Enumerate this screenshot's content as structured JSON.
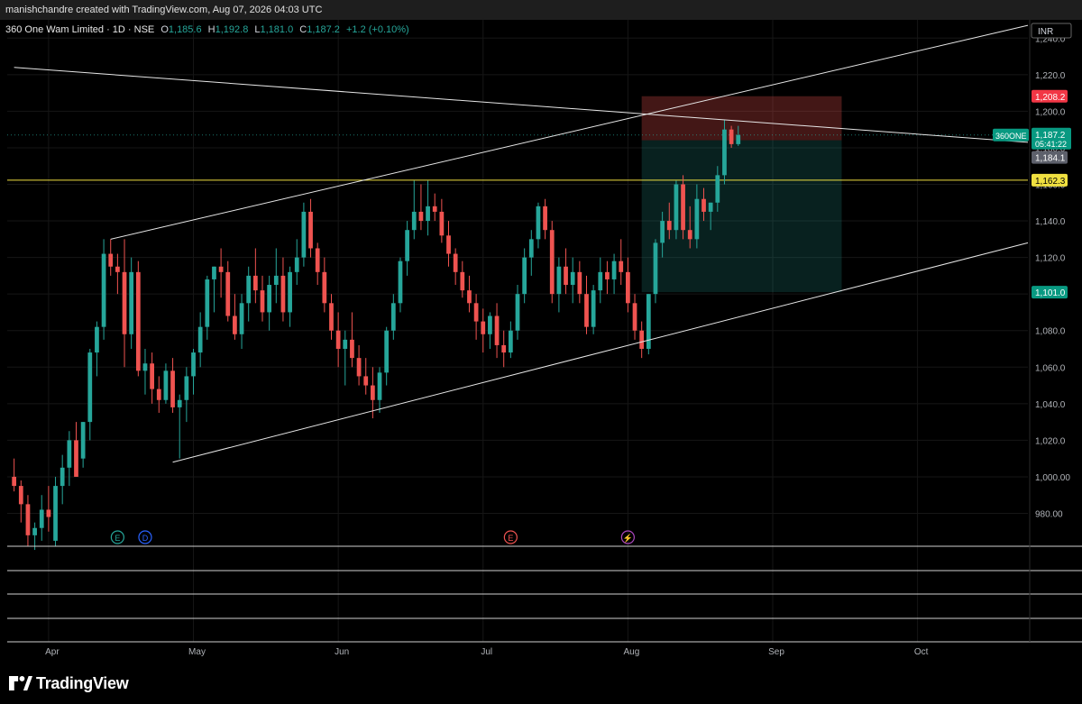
{
  "header": {
    "created_by": "manishchandre created with TradingView.com, Aug 07, 2026 04:03 UTC"
  },
  "legend": {
    "title": "360 One Wam Limited · 1D · NSE",
    "open_label": "O",
    "open": "1,185.6",
    "high_label": "H",
    "high": "1,192.8",
    "low_label": "L",
    "low": "1,181.0",
    "close_label": "C",
    "close": "1,187.2",
    "change": "+1.2 (+0.10%)"
  },
  "currency": "INR",
  "price_tags": {
    "stop": "1,208.2",
    "symbol": "360ONE",
    "last": "1,187.2",
    "countdown": "05:41:22",
    "prev": "1,184.1",
    "hline": "1,162.3",
    "target": "1,101.0"
  },
  "colors": {
    "up": "#26a69a",
    "down": "#ef5350",
    "hline": "#f0e040",
    "background": "#000000"
  },
  "events": [
    {
      "label": "E",
      "kind": "earnings"
    },
    {
      "label": "D",
      "kind": "dividend"
    },
    {
      "label": "E",
      "kind": "earnings"
    },
    {
      "label": "⚡",
      "kind": "split"
    }
  ],
  "brand": "TradingView",
  "chart_data": {
    "type": "candlestick",
    "symbol": "360ONE",
    "ylim": [
      962,
      1250
    ],
    "y_ticks": [
      "980.00",
      "1,000.00",
      "1,020.0",
      "1,040.0",
      "1,060.0",
      "1,080.0",
      "1,100.0",
      "1,120.0",
      "1,140.0",
      "1,160.0",
      "1,180.0",
      "1,200.0",
      "1,220.0",
      "1,240.0"
    ],
    "y_tick_values": [
      980,
      1000,
      1020,
      1040,
      1060,
      1080,
      1100,
      1120,
      1140,
      1160,
      1180,
      1200,
      1220,
      1240
    ],
    "x_ticks": [
      {
        "label": "Apr",
        "index": 5
      },
      {
        "label": "May",
        "index": 26
      },
      {
        "label": "Jun",
        "index": 47
      },
      {
        "label": "Jul",
        "index": 68
      },
      {
        "label": "Aug",
        "index": 89
      },
      {
        "label": "Sep",
        "index": 110
      },
      {
        "label": "Oct",
        "index": 131
      }
    ],
    "x_range": [
      -1,
      147
    ],
    "horizontal_line": 1162.3,
    "position": {
      "type": "short",
      "entry": 1184.1,
      "stop": 1208.2,
      "target": 1101.0,
      "start_index": 91,
      "end_index": 120
    },
    "trendlines": [
      {
        "name": "upper channel",
        "from": [
          14,
          1130
        ],
        "to": [
          147,
          1247
        ]
      },
      {
        "name": "lower channel",
        "from": [
          23,
          1008
        ],
        "to": [
          147,
          1128
        ]
      },
      {
        "name": "descending",
        "from": [
          0,
          1224
        ],
        "to": [
          147,
          1183
        ]
      }
    ],
    "candles": [
      [
        1000,
        1010,
        992,
        995
      ],
      [
        995,
        998,
        975,
        985
      ],
      [
        985,
        990,
        962,
        968
      ],
      [
        968,
        975,
        960,
        972
      ],
      [
        972,
        990,
        965,
        982
      ],
      [
        982,
        995,
        970,
        978
      ],
      [
        965,
        1000,
        962,
        995
      ],
      [
        995,
        1012,
        985,
        1005
      ],
      [
        1005,
        1025,
        995,
        1020
      ],
      [
        1020,
        1030,
        1000,
        1000
      ],
      [
        1010,
        1030,
        1005,
        1030
      ],
      [
        1030,
        1070,
        1020,
        1068
      ],
      [
        1068,
        1085,
        1055,
        1082
      ],
      [
        1082,
        1130,
        1075,
        1122
      ],
      [
        1122,
        1130,
        1110,
        1115
      ],
      [
        1115,
        1122,
        1100,
        1112
      ],
      [
        1112,
        1130,
        1060,
        1078
      ],
      [
        1078,
        1120,
        1070,
        1112
      ],
      [
        1112,
        1118,
        1055,
        1058
      ],
      [
        1058,
        1070,
        1045,
        1062
      ],
      [
        1062,
        1068,
        1040,
        1048
      ],
      [
        1048,
        1055,
        1035,
        1042
      ],
      [
        1042,
        1062,
        1040,
        1058
      ],
      [
        1058,
        1065,
        1035,
        1038
      ],
      [
        1038,
        1045,
        1010,
        1042
      ],
      [
        1042,
        1060,
        1030,
        1055
      ],
      [
        1055,
        1070,
        1045,
        1068
      ],
      [
        1068,
        1090,
        1060,
        1082
      ],
      [
        1082,
        1110,
        1075,
        1108
      ],
      [
        1108,
        1115,
        1090,
        1115
      ],
      [
        1115,
        1125,
        1098,
        1112
      ],
      [
        1112,
        1118,
        1085,
        1088
      ],
      [
        1088,
        1100,
        1075,
        1078
      ],
      [
        1078,
        1100,
        1070,
        1095
      ],
      [
        1095,
        1115,
        1085,
        1110
      ],
      [
        1110,
        1125,
        1095,
        1102
      ],
      [
        1102,
        1110,
        1085,
        1090
      ],
      [
        1090,
        1110,
        1080,
        1105
      ],
      [
        1105,
        1125,
        1095,
        1110
      ],
      [
        1110,
        1120,
        1085,
        1090
      ],
      [
        1090,
        1115,
        1082,
        1112
      ],
      [
        1112,
        1130,
        1105,
        1120
      ],
      [
        1120,
        1150,
        1115,
        1145
      ],
      [
        1145,
        1152,
        1120,
        1125
      ],
      [
        1125,
        1128,
        1105,
        1112
      ],
      [
        1112,
        1120,
        1090,
        1095
      ],
      [
        1095,
        1100,
        1075,
        1080
      ],
      [
        1080,
        1090,
        1060,
        1070
      ],
      [
        1070,
        1080,
        1050,
        1075
      ],
      [
        1075,
        1090,
        1060,
        1065
      ],
      [
        1065,
        1072,
        1050,
        1055
      ],
      [
        1055,
        1065,
        1045,
        1050
      ],
      [
        1050,
        1060,
        1032,
        1042
      ],
      [
        1042,
        1060,
        1035,
        1057
      ],
      [
        1057,
        1082,
        1050,
        1080
      ],
      [
        1080,
        1100,
        1075,
        1095
      ],
      [
        1095,
        1120,
        1090,
        1118
      ],
      [
        1118,
        1140,
        1110,
        1135
      ],
      [
        1135,
        1162,
        1130,
        1145
      ],
      [
        1145,
        1160,
        1135,
        1140
      ],
      [
        1140,
        1162,
        1132,
        1148
      ],
      [
        1148,
        1155,
        1140,
        1145
      ],
      [
        1145,
        1152,
        1128,
        1132
      ],
      [
        1132,
        1140,
        1115,
        1122
      ],
      [
        1122,
        1125,
        1105,
        1112
      ],
      [
        1112,
        1118,
        1098,
        1102
      ],
      [
        1102,
        1110,
        1090,
        1095
      ],
      [
        1095,
        1100,
        1075,
        1085
      ],
      [
        1085,
        1092,
        1068,
        1078
      ],
      [
        1078,
        1090,
        1070,
        1088
      ],
      [
        1088,
        1095,
        1065,
        1072
      ],
      [
        1072,
        1080,
        1060,
        1068
      ],
      [
        1068,
        1085,
        1065,
        1080
      ],
      [
        1080,
        1105,
        1075,
        1100
      ],
      [
        1100,
        1125,
        1095,
        1120
      ],
      [
        1120,
        1135,
        1110,
        1130
      ],
      [
        1130,
        1150,
        1125,
        1148
      ],
      [
        1148,
        1152,
        1130,
        1135
      ],
      [
        1135,
        1140,
        1095,
        1100
      ],
      [
        1100,
        1120,
        1090,
        1115
      ],
      [
        1115,
        1125,
        1100,
        1105
      ],
      [
        1105,
        1120,
        1095,
        1112
      ],
      [
        1112,
        1118,
        1095,
        1100
      ],
      [
        1100,
        1110,
        1078,
        1082
      ],
      [
        1082,
        1105,
        1078,
        1102
      ],
      [
        1102,
        1120,
        1095,
        1112
      ],
      [
        1112,
        1118,
        1100,
        1108
      ],
      [
        1108,
        1122,
        1100,
        1118
      ],
      [
        1118,
        1130,
        1105,
        1112
      ],
      [
        1112,
        1120,
        1090,
        1095
      ],
      [
        1095,
        1100,
        1075,
        1080
      ],
      [
        1080,
        1085,
        1065,
        1070
      ],
      [
        1070,
        1100,
        1067,
        1100
      ],
      [
        1100,
        1130,
        1095,
        1128
      ],
      [
        1128,
        1145,
        1120,
        1140
      ],
      [
        1140,
        1150,
        1130,
        1135
      ],
      [
        1135,
        1162,
        1130,
        1160
      ],
      [
        1160,
        1165,
        1130,
        1135
      ],
      [
        1135,
        1148,
        1125,
        1130
      ],
      [
        1130,
        1160,
        1125,
        1152
      ],
      [
        1152,
        1158,
        1140,
        1145
      ],
      [
        1145,
        1150,
        1135,
        1150
      ],
      [
        1150,
        1170,
        1145,
        1165
      ],
      [
        1165,
        1195,
        1160,
        1190
      ],
      [
        1190,
        1192,
        1180,
        1182
      ],
      [
        1182,
        1192,
        1181,
        1187
      ]
    ]
  }
}
